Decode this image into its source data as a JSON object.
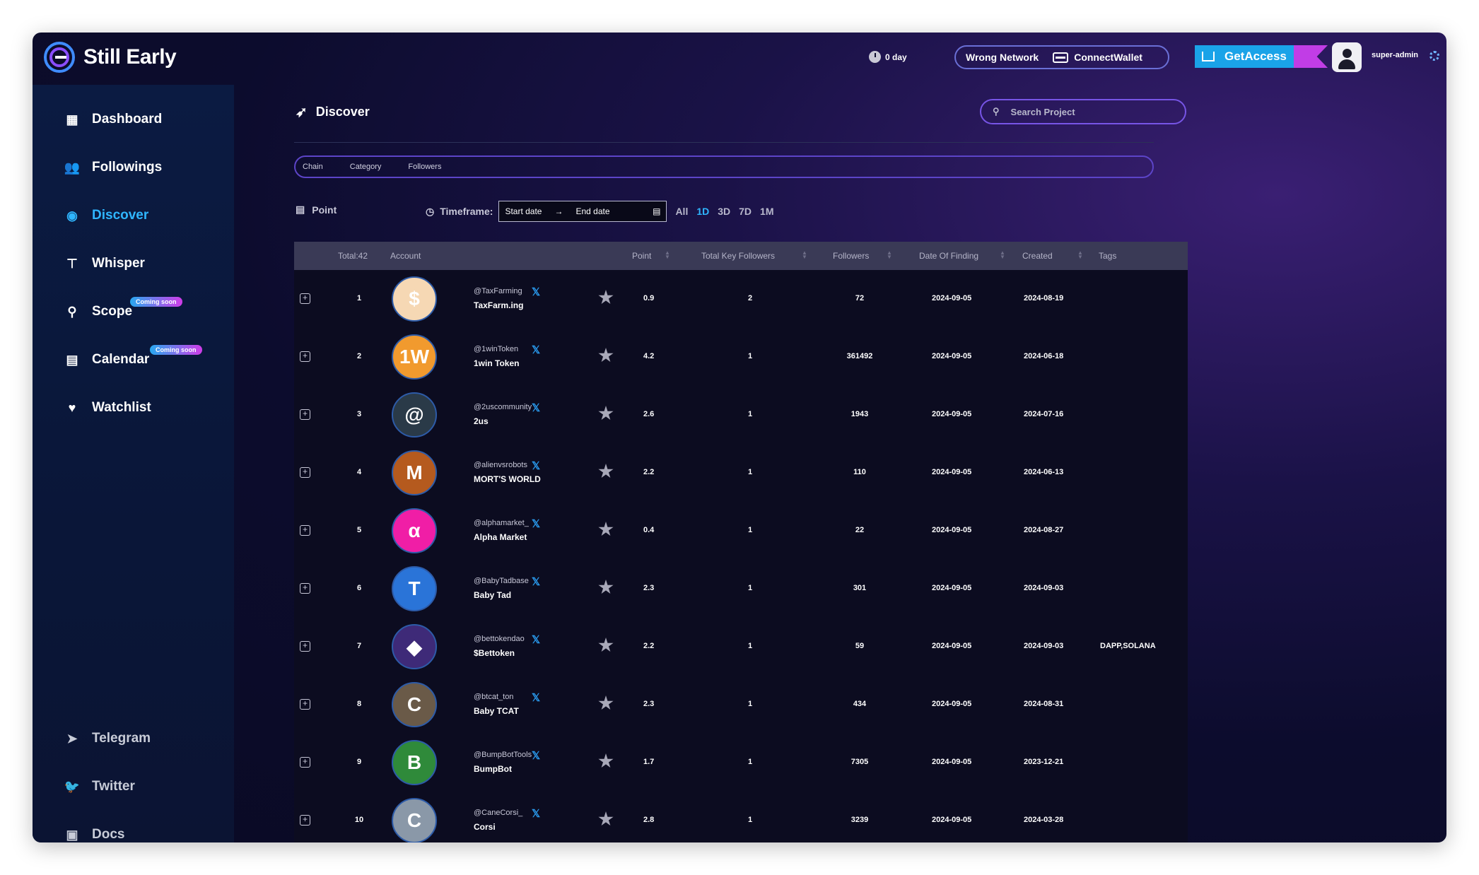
{
  "app": {
    "brand": "Still Early"
  },
  "topbar": {
    "days": "0 day",
    "network": "Wrong Network",
    "wallet": "ConnectWallet",
    "access": "GetAccess",
    "user": "super-admin"
  },
  "sidebar": {
    "items": [
      {
        "label": "Dashboard",
        "icon": "dashboard-icon"
      },
      {
        "label": "Followings",
        "icon": "users-icon"
      },
      {
        "label": "Discover",
        "icon": "globe-icon",
        "active": true
      },
      {
        "label": "Whisper",
        "icon": "paint-roller-icon"
      },
      {
        "label": "Scope",
        "icon": "search-icon",
        "badge": "Coming soon"
      },
      {
        "label": "Calendar",
        "icon": "calendar-icon",
        "badge": "Coming soon"
      },
      {
        "label": "Watchlist",
        "icon": "heart-icon"
      }
    ],
    "links": [
      {
        "label": "Telegram",
        "icon": "telegram-icon"
      },
      {
        "label": "Twitter",
        "icon": "twitter-icon"
      },
      {
        "label": "Docs",
        "icon": "docs-icon"
      }
    ]
  },
  "main": {
    "title": "Discover",
    "search_placeholder": "Search Project",
    "filters": [
      "Chain",
      "Category",
      "Followers"
    ],
    "point_label": "Point",
    "timeframe_label": "Timeframe:",
    "start_date": "Start date",
    "end_date": "End date",
    "timeframe_options": [
      "All",
      "1D",
      "3D",
      "7D",
      "1M"
    ],
    "active_timeframe": "1D"
  },
  "table": {
    "headers": {
      "total": "Total:42",
      "account": "Account",
      "point": "Point",
      "tkf": "Total Key Followers",
      "followers": "Followers",
      "dof": "Date Of Finding",
      "created": "Created",
      "tags": "Tags"
    },
    "rows": [
      {
        "idx": "1",
        "handle": "@TaxFarming",
        "name": "TaxFarm.ing",
        "point": "0.9",
        "tkf": "2",
        "followers": "72",
        "dof": "2024-09-05",
        "created": "2024-08-19",
        "tags": "",
        "color": "#f6d8b4",
        "glyph": "$"
      },
      {
        "idx": "2",
        "handle": "@1winToken",
        "name": "1win Token",
        "point": "4.2",
        "tkf": "1",
        "followers": "361492",
        "dof": "2024-09-05",
        "created": "2024-06-18",
        "tags": "",
        "color": "#f19a2e",
        "glyph": "1W"
      },
      {
        "idx": "3",
        "handle": "@2uscommunity",
        "name": "2us",
        "point": "2.6",
        "tkf": "1",
        "followers": "1943",
        "dof": "2024-09-05",
        "created": "2024-07-16",
        "tags": "",
        "color": "#2a3a48",
        "glyph": "@"
      },
      {
        "idx": "4",
        "handle": "@alienvsrobots",
        "name": "MORT'S WORLD",
        "point": "2.2",
        "tkf": "1",
        "followers": "110",
        "dof": "2024-09-05",
        "created": "2024-06-13",
        "tags": "",
        "color": "#b55a1e",
        "glyph": "M"
      },
      {
        "idx": "5",
        "handle": "@alphamarket_",
        "name": "Alpha Market",
        "point": "0.4",
        "tkf": "1",
        "followers": "22",
        "dof": "2024-09-05",
        "created": "2024-08-27",
        "tags": "",
        "color": "#f01ea6",
        "glyph": "α"
      },
      {
        "idx": "6",
        "handle": "@BabyTadbase",
        "name": "Baby Tad",
        "point": "2.3",
        "tkf": "1",
        "followers": "301",
        "dof": "2024-09-05",
        "created": "2024-09-03",
        "tags": "",
        "color": "#2a74d8",
        "glyph": "T"
      },
      {
        "idx": "7",
        "handle": "@bettokendao",
        "name": "$Bettoken",
        "point": "2.2",
        "tkf": "1",
        "followers": "59",
        "dof": "2024-09-05",
        "created": "2024-09-03",
        "tags": "DAPP,SOLANA",
        "color": "#3e2a78",
        "glyph": "◆"
      },
      {
        "idx": "8",
        "handle": "@btcat_ton",
        "name": "Baby TCAT",
        "point": "2.3",
        "tkf": "1",
        "followers": "434",
        "dof": "2024-09-05",
        "created": "2024-08-31",
        "tags": "",
        "color": "#6a5a48",
        "glyph": "C"
      },
      {
        "idx": "9",
        "handle": "@BumpBotTools",
        "name": "BumpBot",
        "point": "1.7",
        "tkf": "1",
        "followers": "7305",
        "dof": "2024-09-05",
        "created": "2023-12-21",
        "tags": "",
        "color": "#2f8a3a",
        "glyph": "B"
      },
      {
        "idx": "10",
        "handle": "@CaneCorsi_",
        "name": "Corsi",
        "point": "2.8",
        "tkf": "1",
        "followers": "3239",
        "dof": "2024-09-05",
        "created": "2024-03-28",
        "tags": "",
        "color": "#8a98a8",
        "glyph": "C"
      }
    ]
  }
}
